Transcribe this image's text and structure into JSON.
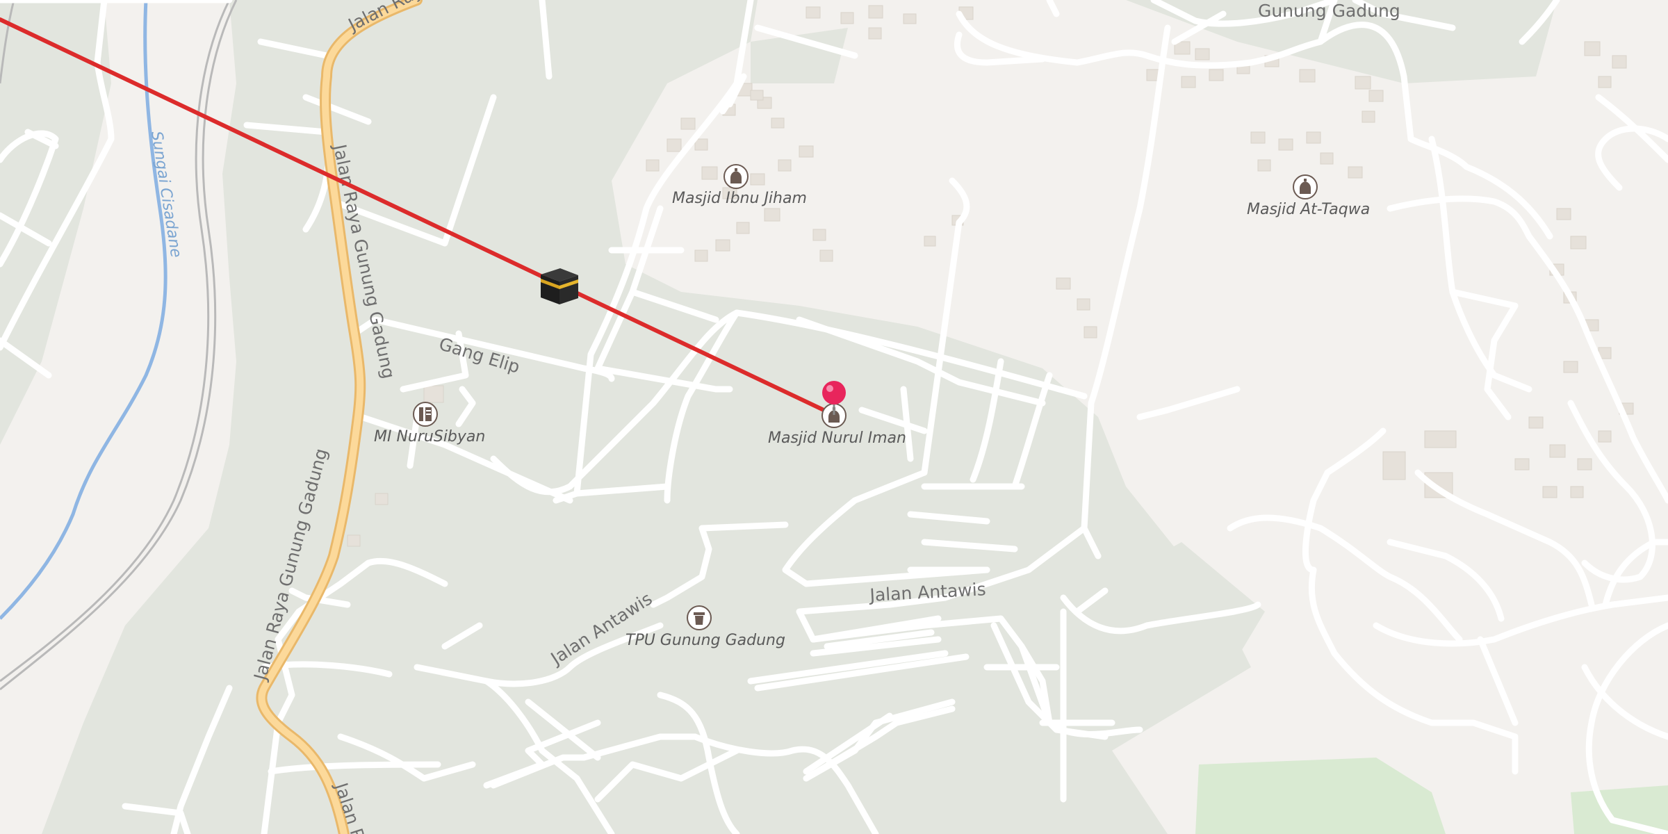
{
  "map": {
    "colors": {
      "background": "#f3f1ee",
      "greenery": "#e2e5de",
      "park": "#d9ead2",
      "road": "#ffffff",
      "main_road": "#fcd99a",
      "main_road_casing": "#e9b86a",
      "building": "#e6e1da",
      "river": "#8fb6e3",
      "rail": "#b9b9b9",
      "route_line": "#dc2b2b",
      "pin": "#e8255c"
    },
    "road_labels": {
      "jalan_raya_top": "Jalan Raya",
      "jalan_raya_gunung_gadung_north": "Jalan Raya Gunung Gadung",
      "jalan_raya_gunung_gadung_south": "Jalan Raya Gunung Gadung",
      "jalan_raya_bottom": "Jalan R",
      "gang_elip": "Gang Elip",
      "jalan_antawis_west": "Jalan Antawis",
      "jalan_antawis_east": "Jalan Antawis",
      "gunung_gadung_area": "Gunung Gadung"
    },
    "river_label": "Sungai Cisadane",
    "pois": [
      {
        "id": "masjid-ibnu-jiham",
        "label": "Masjid Ibnu Jiham",
        "icon": "mosque-icon"
      },
      {
        "id": "masjid-at-taqwa",
        "label": "Masjid At-Taqwa",
        "icon": "mosque-icon"
      },
      {
        "id": "masjid-nurul-iman",
        "label": "Masjid Nurul Iman",
        "icon": "mosque-icon"
      },
      {
        "id": "mi-nurusibyan",
        "label": "MI NuruSibyan",
        "icon": "school-icon"
      },
      {
        "id": "tpu-gunung-gadung",
        "label": "TPU Gunung Gadung",
        "icon": "cemetery-icon"
      }
    ],
    "markers": {
      "kaaba": "kaaba-icon",
      "location_pin": "location-pin-icon"
    },
    "route": {
      "label": "qibla-direction-line"
    }
  }
}
